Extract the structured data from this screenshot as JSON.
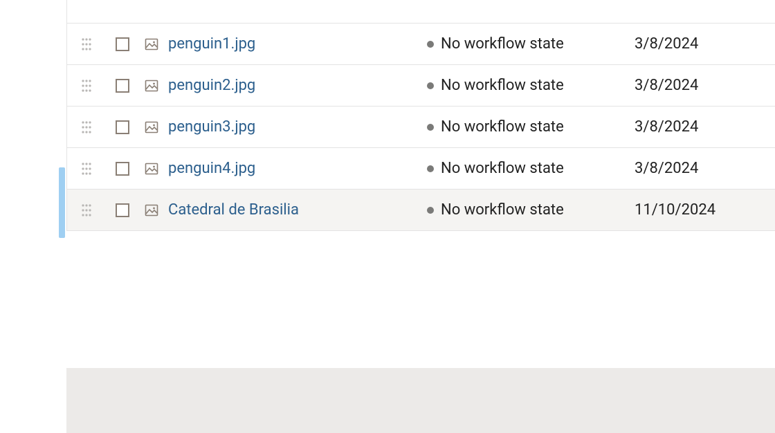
{
  "rows": [
    {
      "name": "penguin1.jpg",
      "workflow": "No workflow state",
      "date": "3/8/2024",
      "hovered": false,
      "highlighted": false
    },
    {
      "name": "penguin2.jpg",
      "workflow": "No workflow state",
      "date": "3/8/2024",
      "hovered": false,
      "highlighted": false
    },
    {
      "name": "penguin3.jpg",
      "workflow": "No workflow state",
      "date": "3/8/2024",
      "hovered": false,
      "highlighted": false
    },
    {
      "name": "penguin4.jpg",
      "workflow": "No workflow state",
      "date": "3/8/2024",
      "hovered": false,
      "highlighted": false
    },
    {
      "name": "Catedral de Brasilia",
      "workflow": "No workflow state",
      "date": "11/10/2024",
      "hovered": true,
      "highlighted": true
    }
  ]
}
